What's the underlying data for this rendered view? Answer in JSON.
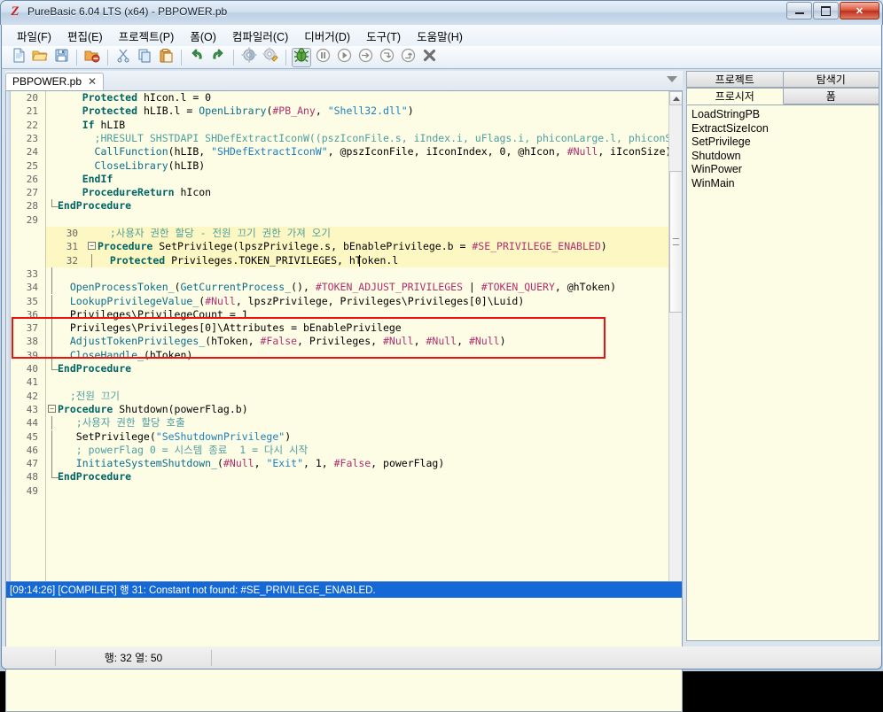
{
  "window": {
    "title": "PureBasic 6.04 LTS (x64) - PBPOWER.pb",
    "app_icon": "purebasic-logo-icon",
    "minimize_label": "",
    "maximize_label": "",
    "close_label": "✕"
  },
  "menubar": {
    "items": [
      {
        "label": "파일(F)",
        "name": "menu-file"
      },
      {
        "label": "편집(E)",
        "name": "menu-edit"
      },
      {
        "label": "프로젝트(P)",
        "name": "menu-project"
      },
      {
        "label": "폼(O)",
        "name": "menu-form"
      },
      {
        "label": "컴파일러(C)",
        "name": "menu-compiler"
      },
      {
        "label": "디버거(D)",
        "name": "menu-debugger"
      },
      {
        "label": "도구(T)",
        "name": "menu-tools"
      },
      {
        "label": "도움말(H)",
        "name": "menu-help"
      }
    ]
  },
  "toolbar": {
    "buttons": [
      {
        "icon": "new-file-icon",
        "title": "New"
      },
      {
        "icon": "open-folder-icon",
        "title": "Open"
      },
      {
        "icon": "save-disk-icon",
        "title": "Save"
      },
      {
        "icon": "close-file-icon",
        "title": "Close"
      },
      {
        "icon": "cut-scissors-icon",
        "title": "Cut"
      },
      {
        "icon": "copy-icon",
        "title": "Copy"
      },
      {
        "icon": "paste-clipboard-icon",
        "title": "Paste"
      },
      {
        "icon": "undo-arrow-icon",
        "title": "Undo"
      },
      {
        "icon": "redo-arrow-icon",
        "title": "Redo"
      },
      {
        "icon": "compile-gear-icon",
        "title": "Compile"
      },
      {
        "icon": "compile-options-gear-icon",
        "title": "Compiler Options"
      },
      {
        "icon": "debug-bug-icon",
        "title": "Debugger"
      },
      {
        "icon": "pause-icon",
        "title": "Pause"
      },
      {
        "icon": "run-play-icon",
        "title": "Run"
      },
      {
        "icon": "step-over-icon",
        "title": "Step"
      },
      {
        "icon": "step-into-icon",
        "title": "Step Into"
      },
      {
        "icon": "step-out-icon",
        "title": "Step Out"
      },
      {
        "icon": "stop-x-icon",
        "title": "Stop"
      }
    ]
  },
  "editor": {
    "tab": {
      "filename": "PBPOWER.pb",
      "close_glyph": "✕"
    },
    "dropdown_icon": "chevron-down-icon",
    "caret": {
      "line": 32,
      "col": 50
    },
    "lines": [
      {
        "n": "20",
        "fold": "",
        "indent": 0,
        "tokens": [
          {
            "t": "    ",
            "c": "op"
          },
          {
            "t": "Protected",
            "c": "kw"
          },
          {
            "t": " hIcon.l = 0",
            "c": "id"
          }
        ]
      },
      {
        "n": "21",
        "fold": "",
        "indent": 0,
        "tokens": [
          {
            "t": "    ",
            "c": "op"
          },
          {
            "t": "Protected",
            "c": "kw"
          },
          {
            "t": " hLIB.l = ",
            "c": "id"
          },
          {
            "t": "OpenLibrary",
            "c": "api"
          },
          {
            "t": "(",
            "c": "op"
          },
          {
            "t": "#PB_Any",
            "c": "con"
          },
          {
            "t": ", ",
            "c": "op"
          },
          {
            "t": "\"Shell32.dll\"",
            "c": "str"
          },
          {
            "t": ")",
            "c": "op"
          }
        ]
      },
      {
        "n": "22",
        "fold": "",
        "indent": 0,
        "tokens": [
          {
            "t": "    ",
            "c": "op"
          },
          {
            "t": "If",
            "c": "kw"
          },
          {
            "t": " hLIB",
            "c": "id"
          }
        ]
      },
      {
        "n": "23",
        "fold": "",
        "indent": 0,
        "tokens": [
          {
            "t": "      ;HRESULT SHSTDAPI SHDefExtractIconW((pszIconFile.s, iIndex.i, uFlags.i, phiconLarge.l, phiconSm",
            "c": "cmt"
          }
        ]
      },
      {
        "n": "24",
        "fold": "",
        "indent": 0,
        "tokens": [
          {
            "t": "      ",
            "c": "op"
          },
          {
            "t": "CallFunction",
            "c": "api"
          },
          {
            "t": "(hLIB, ",
            "c": "op"
          },
          {
            "t": "\"SHDefExtractIconW\"",
            "c": "str"
          },
          {
            "t": ", @pszIconFile, iIconIndex, 0, @hIcon, ",
            "c": "op"
          },
          {
            "t": "#Null",
            "c": "con"
          },
          {
            "t": ", iIconSize)",
            "c": "op"
          }
        ]
      },
      {
        "n": "25",
        "fold": "",
        "indent": 0,
        "tokens": [
          {
            "t": "      ",
            "c": "op"
          },
          {
            "t": "CloseLibrary",
            "c": "api"
          },
          {
            "t": "(hLIB)",
            "c": "op"
          }
        ]
      },
      {
        "n": "26",
        "fold": "",
        "indent": 0,
        "tokens": [
          {
            "t": "    ",
            "c": "op"
          },
          {
            "t": "EndIf",
            "c": "kw"
          }
        ]
      },
      {
        "n": "27",
        "fold": "",
        "indent": 0,
        "tokens": [
          {
            "t": "    ",
            "c": "op"
          },
          {
            "t": "ProcedureReturn",
            "c": "kw"
          },
          {
            "t": " hIcon",
            "c": "id"
          }
        ]
      },
      {
        "n": "28",
        "fold": "end",
        "indent": 0,
        "tokens": [
          {
            "t": "EndProcedure",
            "c": "kw"
          }
        ]
      },
      {
        "n": "29",
        "fold": "",
        "indent": 0,
        "tokens": []
      },
      {
        "n": "30",
        "fold": "",
        "indent": 0,
        "hl": true,
        "tokens": [
          {
            "t": "  ;사용자 권한 할당 - 전원 끄기 권한 가져 오기",
            "c": "cmt"
          }
        ]
      },
      {
        "n": "31",
        "fold": "open",
        "indent": 0,
        "hl": true,
        "tokens": [
          {
            "t": "Procedure",
            "c": "kw"
          },
          {
            "t": " SetPrivilege",
            "c": "id"
          },
          {
            "t": "(lpszPrivilege.s, bEnablePrivilege.b = ",
            "c": "op"
          },
          {
            "t": "#SE_PRIVILEGE_ENABLED",
            "c": "con"
          },
          {
            "t": ")",
            "c": "op"
          }
        ]
      },
      {
        "n": "32",
        "fold": "bar",
        "indent": 0,
        "hl": true,
        "tokens": [
          {
            "t": "  ",
            "c": "op"
          },
          {
            "t": "Protected",
            "c": "kw"
          },
          {
            "t": " Privileges.TOKEN_PRIVILEGES, hToken.l",
            "c": "id"
          }
        ]
      },
      {
        "n": "33",
        "fold": "bar",
        "indent": 0,
        "tokens": []
      },
      {
        "n": "34",
        "fold": "bar",
        "indent": 0,
        "tokens": [
          {
            "t": "  ",
            "c": "op"
          },
          {
            "t": "OpenProcessToken_",
            "c": "api"
          },
          {
            "t": "(",
            "c": "op"
          },
          {
            "t": "GetCurrentProcess_",
            "c": "api"
          },
          {
            "t": "(), ",
            "c": "op"
          },
          {
            "t": "#TOKEN_ADJUST_PRIVILEGES",
            "c": "con"
          },
          {
            "t": " | ",
            "c": "op"
          },
          {
            "t": "#TOKEN_QUERY",
            "c": "con"
          },
          {
            "t": ", @hToken)",
            "c": "op"
          }
        ]
      },
      {
        "n": "35",
        "fold": "bar",
        "indent": 0,
        "tokens": [
          {
            "t": "  ",
            "c": "op"
          },
          {
            "t": "LookupPrivilegeValue_",
            "c": "api"
          },
          {
            "t": "(",
            "c": "op"
          },
          {
            "t": "#Null",
            "c": "con"
          },
          {
            "t": ", lpszPrivilege, Privileges\\Privileges[0]\\Luid)",
            "c": "op"
          }
        ]
      },
      {
        "n": "36",
        "fold": "bar",
        "indent": 0,
        "tokens": [
          {
            "t": "  Privileges\\PrivilegeCount = ",
            "c": "op"
          },
          {
            "t": "1",
            "c": "num"
          }
        ]
      },
      {
        "n": "37",
        "fold": "bar",
        "indent": 0,
        "tokens": [
          {
            "t": "  Privileges\\Privileges[0]\\Attributes = bEnablePrivilege",
            "c": "op"
          }
        ]
      },
      {
        "n": "38",
        "fold": "bar",
        "indent": 0,
        "tokens": [
          {
            "t": "  ",
            "c": "op"
          },
          {
            "t": "AdjustTokenPrivileges_",
            "c": "api"
          },
          {
            "t": "(hToken, ",
            "c": "op"
          },
          {
            "t": "#False",
            "c": "con"
          },
          {
            "t": ", Privileges, ",
            "c": "op"
          },
          {
            "t": "#Null",
            "c": "con"
          },
          {
            "t": ", ",
            "c": "op"
          },
          {
            "t": "#Null",
            "c": "con"
          },
          {
            "t": ", ",
            "c": "op"
          },
          {
            "t": "#Null",
            "c": "con"
          },
          {
            "t": ")",
            "c": "op"
          }
        ]
      },
      {
        "n": "39",
        "fold": "bar",
        "indent": 0,
        "tokens": [
          {
            "t": "  ",
            "c": "op"
          },
          {
            "t": "CloseHandle_",
            "c": "api"
          },
          {
            "t": "(hToken)",
            "c": "op"
          }
        ]
      },
      {
        "n": "40",
        "fold": "end",
        "indent": 0,
        "tokens": [
          {
            "t": "EndProcedure",
            "c": "kw"
          }
        ]
      },
      {
        "n": "41",
        "fold": "",
        "indent": 0,
        "tokens": []
      },
      {
        "n": "42",
        "fold": "",
        "indent": 0,
        "tokens": [
          {
            "t": "  ;전원 끄기",
            "c": "cmt"
          }
        ]
      },
      {
        "n": "43",
        "fold": "open",
        "indent": 0,
        "tokens": [
          {
            "t": "Procedure",
            "c": "kw"
          },
          {
            "t": " Shutdown",
            "c": "id"
          },
          {
            "t": "(powerFlag.b)",
            "c": "op"
          }
        ]
      },
      {
        "n": "44",
        "fold": "bar",
        "indent": 0,
        "tokens": [
          {
            "t": "   ;사용자 권한 할당 호출",
            "c": "cmt"
          }
        ]
      },
      {
        "n": "45",
        "fold": "bar",
        "indent": 0,
        "tokens": [
          {
            "t": "   SetPrivilege(",
            "c": "op"
          },
          {
            "t": "\"SeShutdownPrivilege\"",
            "c": "str"
          },
          {
            "t": ")",
            "c": "op"
          }
        ]
      },
      {
        "n": "46",
        "fold": "bar",
        "indent": 0,
        "tokens": [
          {
            "t": "   ; powerFlag 0 = 시스템 종료  1 = 다시 시작",
            "c": "cmt"
          }
        ]
      },
      {
        "n": "47",
        "fold": "bar",
        "indent": 0,
        "tokens": [
          {
            "t": "   ",
            "c": "op"
          },
          {
            "t": "InitiateSystemShutdown_",
            "c": "api"
          },
          {
            "t": "(",
            "c": "op"
          },
          {
            "t": "#Null",
            "c": "con"
          },
          {
            "t": ", ",
            "c": "op"
          },
          {
            "t": "\"Exit\"",
            "c": "str"
          },
          {
            "t": ", 1, ",
            "c": "op"
          },
          {
            "t": "#False",
            "c": "con"
          },
          {
            "t": ", powerFlag)",
            "c": "op"
          }
        ]
      },
      {
        "n": "48",
        "fold": "end",
        "indent": 0,
        "tokens": [
          {
            "t": "EndProcedure",
            "c": "kw"
          }
        ]
      },
      {
        "n": "49",
        "fold": "",
        "indent": 0,
        "tokens": []
      }
    ]
  },
  "log": {
    "entries": [
      {
        "text": "[09:14:26] [COMPILER] 행 31: Constant not found: #SE_PRIVILEGE_ENABLED.",
        "selected": true
      }
    ]
  },
  "right_panel": {
    "tabs_row1": [
      {
        "label": "프로젝트",
        "name": "tab-project",
        "active": false
      },
      {
        "label": "탐색기",
        "name": "tab-explorer",
        "active": false
      }
    ],
    "tabs_row2": [
      {
        "label": "프로시저",
        "name": "tab-procedures",
        "active": true
      },
      {
        "label": "폼",
        "name": "tab-forms",
        "active": false
      }
    ],
    "procedures": [
      "LoadStringPB",
      "ExtractSizeIcon",
      "SetPrivilege",
      "Shutdown",
      "WinPower",
      "WinMain"
    ]
  },
  "statusbar": {
    "position": "행: 32   열: 50",
    "right": ""
  },
  "colors": {
    "accent_blue": "#1569d6",
    "editor_bg": "#fdfde6",
    "highlight_row": "#fdf7c3",
    "error_box": "#ee1111",
    "keyword": "#006464",
    "api": "#0b6e8c",
    "comment": "#4f9e9e",
    "string": "#1d7fbf",
    "constant": "#b0306f"
  }
}
